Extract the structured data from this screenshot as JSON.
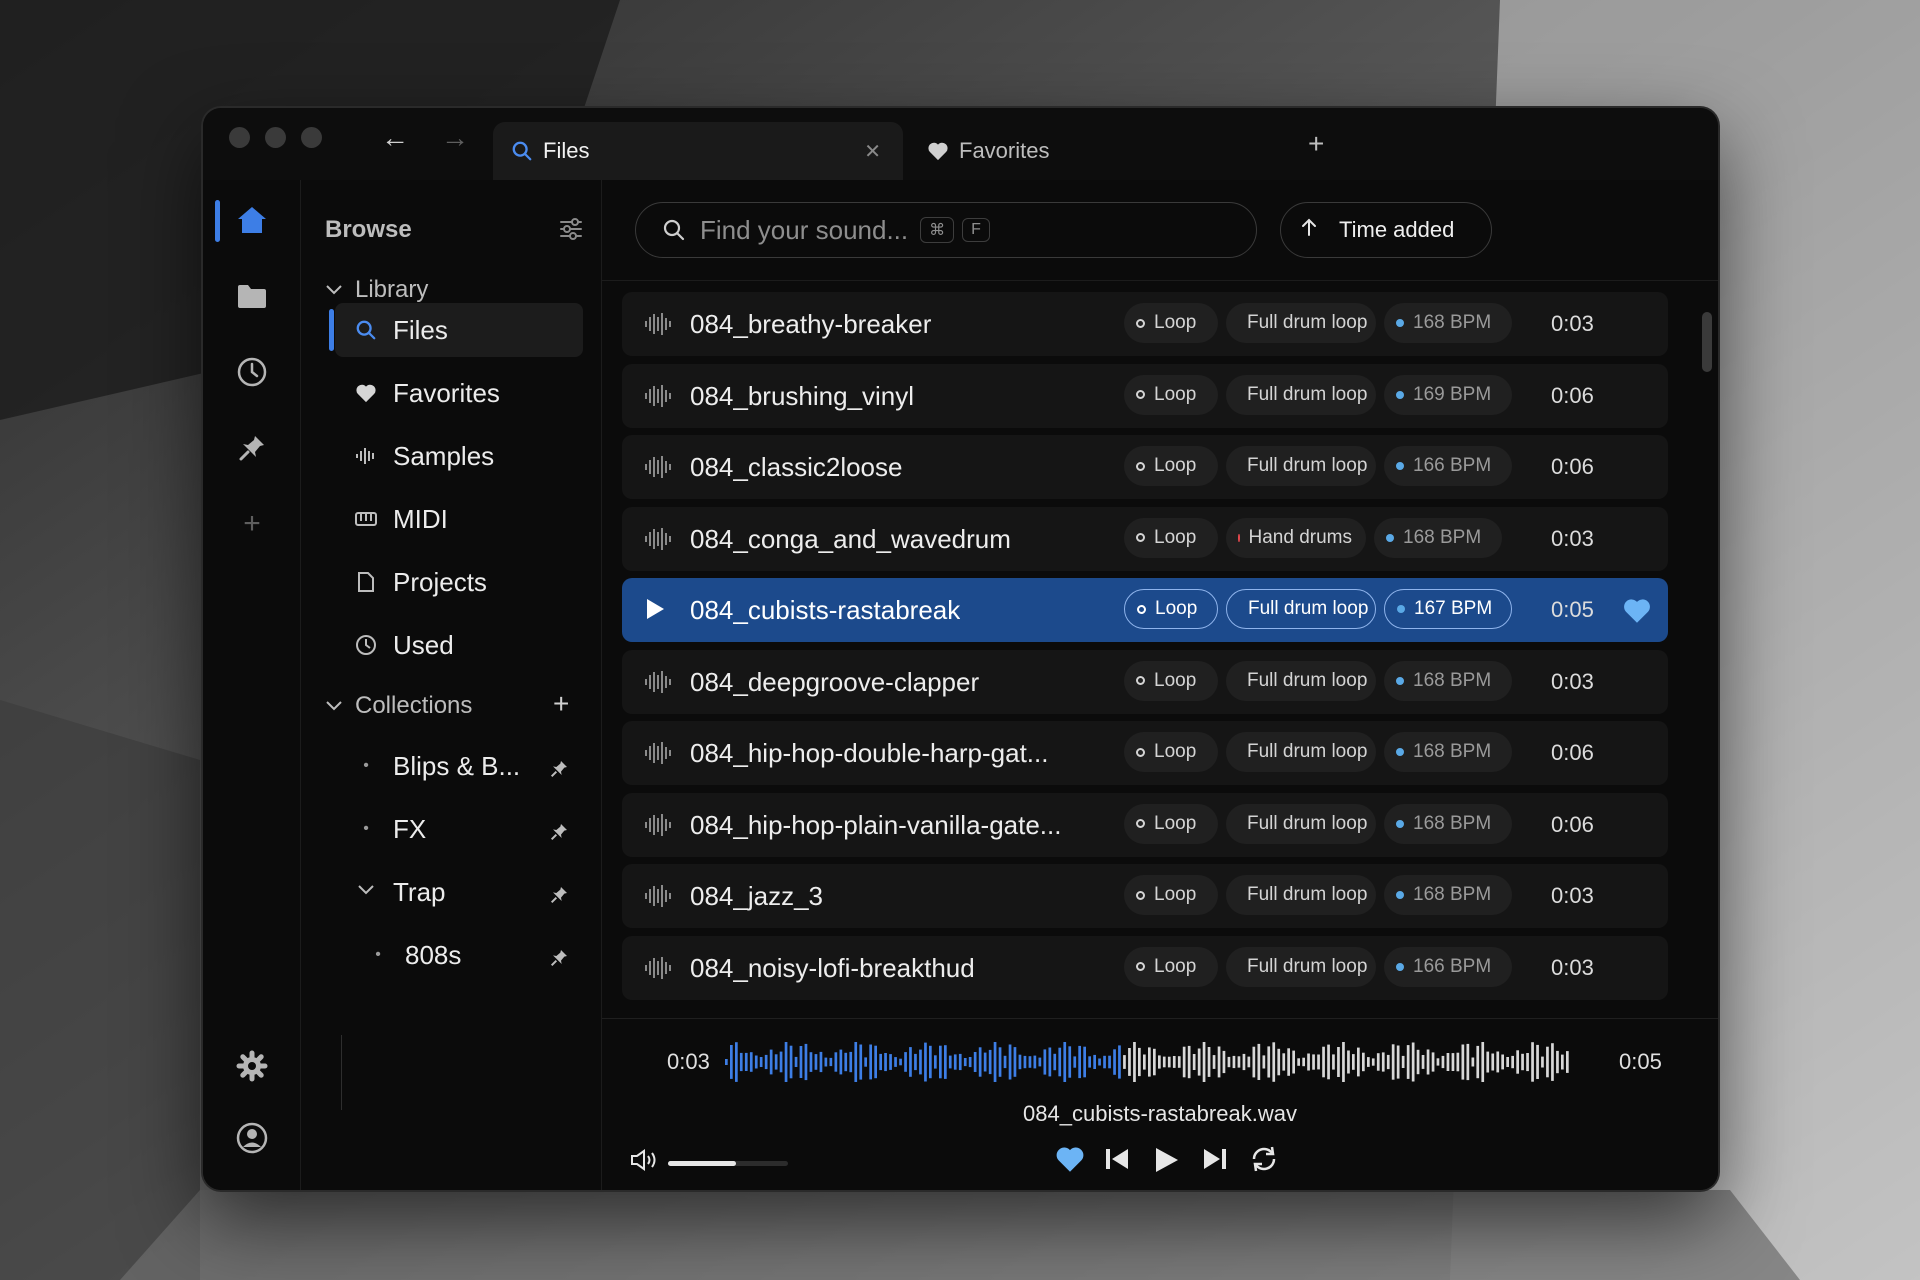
{
  "tabs": [
    {
      "label": "Files"
    },
    {
      "label": "Favorites"
    }
  ],
  "sidebar": {
    "title": "Browse",
    "library_label": "Library",
    "library_items": [
      {
        "label": "Files",
        "icon": "search-icon"
      },
      {
        "label": "Favorites",
        "icon": "heart-icon"
      },
      {
        "label": "Samples",
        "icon": "waveform-icon"
      },
      {
        "label": "MIDI",
        "icon": "piano-icon"
      },
      {
        "label": "Projects",
        "icon": "document-icon"
      },
      {
        "label": "Used",
        "icon": "clock-icon"
      }
    ],
    "collections_label": "Collections",
    "collections": [
      {
        "label": "Blips & B..."
      },
      {
        "label": "FX"
      },
      {
        "label": "Trap"
      },
      {
        "label": "808s"
      }
    ]
  },
  "search": {
    "placeholder": "Find your sound...",
    "shortcut_mod": "⌘",
    "shortcut_key": "F"
  },
  "sort": {
    "label": "Time added"
  },
  "files": [
    {
      "name": "084_breathy-breaker",
      "type": "Loop",
      "category": "Full drum loop",
      "bpm": "168 BPM",
      "duration": "0:03",
      "selected": false
    },
    {
      "name": "084_brushing_vinyl",
      "type": "Loop",
      "category": "Full drum loop",
      "bpm": "169 BPM",
      "duration": "0:06",
      "selected": false
    },
    {
      "name": "084_classic2loose",
      "type": "Loop",
      "category": "Full drum loop",
      "bpm": "166 BPM",
      "duration": "0:06",
      "selected": false
    },
    {
      "name": "084_conga_and_wavedrum",
      "type": "Loop",
      "category": "Hand drums",
      "bpm": "168 BPM",
      "duration": "0:03",
      "selected": false
    },
    {
      "name": "084_cubists-rastabreak",
      "type": "Loop",
      "category": "Full drum loop",
      "bpm": "167 BPM",
      "duration": "0:05",
      "selected": true
    },
    {
      "name": "084_deepgroove-clapper",
      "type": "Loop",
      "category": "Full drum loop",
      "bpm": "168 BPM",
      "duration": "0:03",
      "selected": false
    },
    {
      "name": "084_hip-hop-double-harp-gat...",
      "type": "Loop",
      "category": "Full drum loop",
      "bpm": "168 BPM",
      "duration": "0:06",
      "selected": false
    },
    {
      "name": "084_hip-hop-plain-vanilla-gate...",
      "type": "Loop",
      "category": "Full drum loop",
      "bpm": "168 BPM",
      "duration": "0:06",
      "selected": false
    },
    {
      "name": "084_jazz_3",
      "type": "Loop",
      "category": "Full drum loop",
      "bpm": "168 BPM",
      "duration": "0:03",
      "selected": false
    },
    {
      "name": "084_noisy-lofi-breakthud",
      "type": "Loop",
      "category": "Full drum loop",
      "bpm": "166 BPM",
      "duration": "0:03",
      "selected": false
    }
  ],
  "player": {
    "current_time": "0:03",
    "total_time": "0:05",
    "filename": "084_cubists-rastabreak.wav",
    "volume": 0.57,
    "progress": 0.47
  },
  "colors": {
    "accent": "#3d7ee6",
    "selected_row": "#1c4a8c",
    "category_dot": "#e5484d",
    "bpm_dot": "#5aa9e6",
    "favorite": "#6cb4f5"
  }
}
